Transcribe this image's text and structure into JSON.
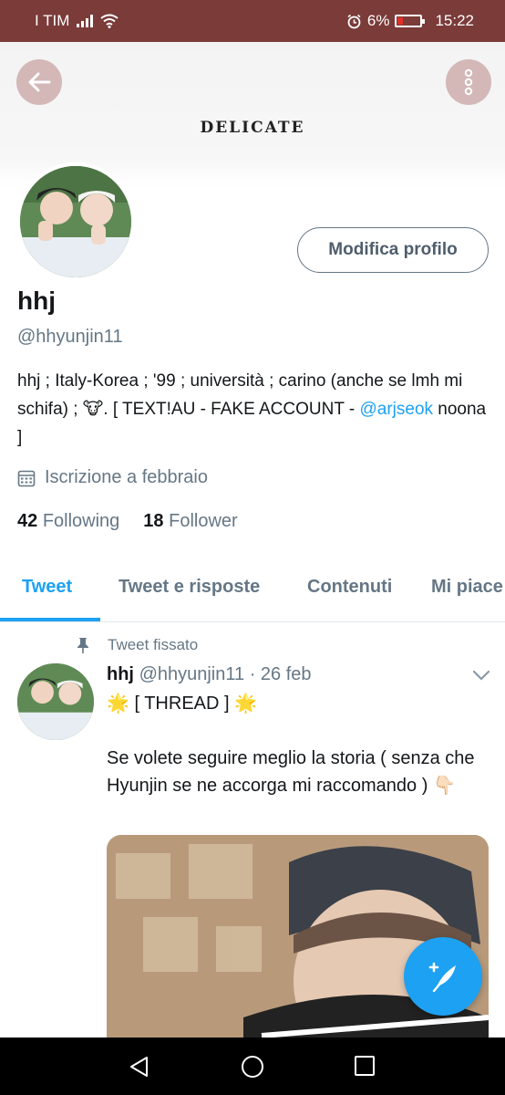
{
  "status_bar": {
    "carrier": "I TIM",
    "battery_percent": "6%",
    "time": "15:22",
    "battery_level": 0.06
  },
  "header": {
    "title": "DELICATE",
    "back_icon": "arrow-left-icon",
    "more_icon": "more-vertical-icon"
  },
  "profile": {
    "edit_button": "Modifica profilo",
    "name": "hhj",
    "handle": "@hhyunjin11",
    "bio_1": "hhj ; Italy-Korea ; '99 ; università ; carino (anche se lmh mi schifa) ; 🐮.  [ TEXT!AU - FAKE ACCOUNT - ",
    "bio_link": "@arjseok",
    "bio_2": " noona ]",
    "joined": "Iscrizione a febbraio",
    "following_count": "42",
    "following_label": "Following",
    "follower_count": "18",
    "follower_label": "Follower"
  },
  "tabs": [
    "Tweet",
    "Tweet e risposte",
    "Contenuti",
    "Mi piace"
  ],
  "tweet": {
    "pinned_label": "Tweet fissato",
    "author_name": "hhj",
    "author_handle": "@hhyunjin11",
    "separator": " · ",
    "date": "26 feb",
    "star_1": "🌟",
    "thread": " [ THREAD ] ",
    "star_2": "🌟",
    "body": "Se volete seguire meglio la storia ( senza che Hyunjin se ne accorga mi raccomando ) 👇🏻"
  },
  "colors": {
    "accent": "#1da1f2",
    "status_bar": "#7a3b39",
    "header_buttons": "#d4b7b7"
  }
}
